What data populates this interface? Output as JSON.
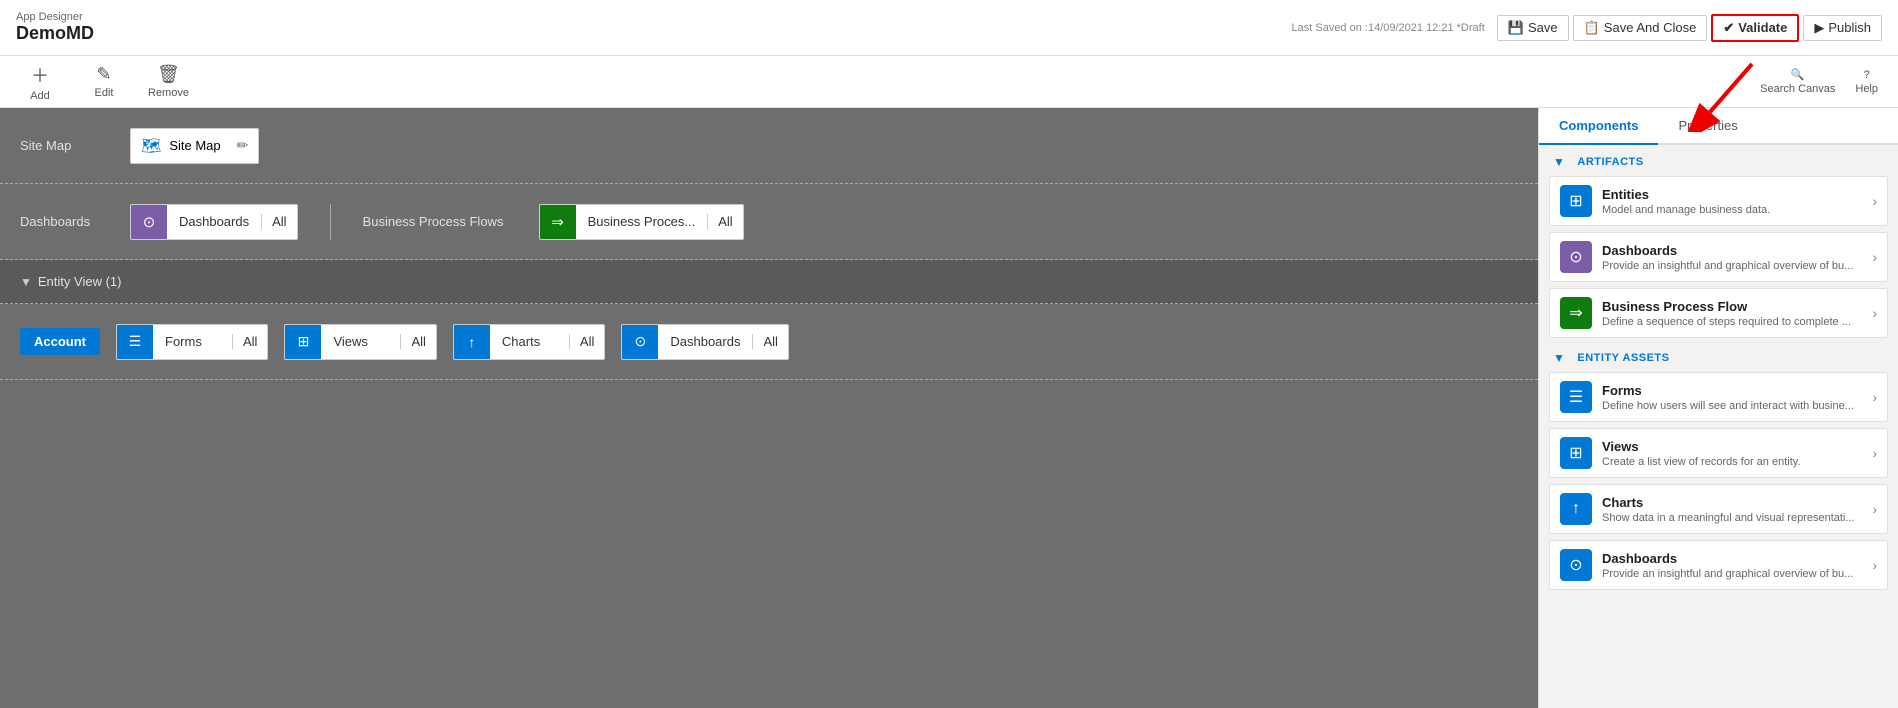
{
  "appDesigner": {
    "label": "App Designer",
    "appName": "DemoMD"
  },
  "topBar": {
    "lastSaved": "Last Saved on :14/09/2021 12:21 *Draft",
    "saveLabel": "Save",
    "saveAndCloseLabel": "Save And Close",
    "validateLabel": "Validate",
    "publishLabel": "Publish"
  },
  "toolbar": {
    "addLabel": "Add",
    "editLabel": "Edit",
    "removeLabel": "Remove",
    "searchCanvasLabel": "Search Canvas",
    "helpLabel": "Help"
  },
  "canvas": {
    "siteMap": {
      "rowLabel": "Site Map",
      "boxLabel": "Site Map"
    },
    "dashboardsRow": {
      "rowLabel": "Dashboards",
      "dashboardsBox": {
        "label": "Dashboards",
        "allLabel": "All"
      },
      "bpfLabel": "Business Process Flows",
      "bpfBox": {
        "label": "Business Proces...",
        "allLabel": "All"
      }
    },
    "entityView": {
      "header": "Entity View (1)",
      "entityName": "Account",
      "formsBox": {
        "label": "Forms",
        "allLabel": "All"
      },
      "viewsBox": {
        "label": "Views",
        "allLabel": "All"
      },
      "chartsBox": {
        "label": "Charts",
        "allLabel": "All"
      },
      "dashboardsBox": {
        "label": "Dashboards",
        "allLabel": "All"
      }
    }
  },
  "rightPanel": {
    "tabs": [
      {
        "label": "Components",
        "active": true
      },
      {
        "label": "Properties",
        "active": false
      }
    ],
    "artifactsHeader": "ARTIFACTS",
    "artifacts": [
      {
        "title": "Entities",
        "desc": "Model and manage business data.",
        "iconType": "blue",
        "iconSymbol": "⊞"
      },
      {
        "title": "Dashboards",
        "desc": "Provide an insightful and graphical overview of bu...",
        "iconType": "purple",
        "iconSymbol": "⊙"
      },
      {
        "title": "Business Process Flow",
        "desc": "Define a sequence of steps required to complete ...",
        "iconType": "green",
        "iconSymbol": "⇒"
      }
    ],
    "entityAssetsHeader": "ENTITY ASSETS",
    "entityAssets": [
      {
        "title": "Forms",
        "desc": "Define how users will see and interact with busine...",
        "iconType": "blue",
        "iconSymbol": "☰"
      },
      {
        "title": "Views",
        "desc": "Create a list view of records for an entity.",
        "iconType": "blue",
        "iconSymbol": "⊞"
      },
      {
        "title": "Charts",
        "desc": "Show data in a meaningful and visual representati...",
        "iconType": "blue",
        "iconSymbol": "↑"
      },
      {
        "title": "Dashboards",
        "desc": "Provide an insightful and graphical overview of bu...",
        "iconType": "blue",
        "iconSymbol": "⊙"
      }
    ]
  }
}
